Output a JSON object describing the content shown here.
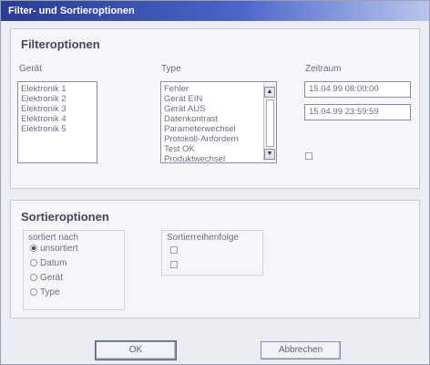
{
  "window": {
    "title": "Filter- und Sortieroptionen"
  },
  "filter": {
    "title": "Filteroptionen",
    "geraet": {
      "label": "Gerät",
      "items": [
        "Elektronik 1",
        "Elektronik 2",
        "Elektronik 3",
        "Elektronik 4",
        "Elektronik 5"
      ]
    },
    "type": {
      "label": "Type",
      "items": [
        "Fehler",
        "Gerät EIN",
        "Gerät AUS",
        "Datenkontrast",
        "Parameterwechsel",
        "Protokoll-Anfordern",
        "Test OK",
        "Produktwechsel"
      ]
    },
    "zeitraum": {
      "label": "Zeitraum",
      "from": "15.04.99 08:00:00",
      "to": "15.04.99 23:59:59"
    }
  },
  "sort": {
    "title": "Sortieroptionen",
    "sortiert_nach": {
      "label": "sortiert nach",
      "options": [
        "unsortiert",
        "Datum",
        "Gerät",
        "Type"
      ],
      "selected": "unsortiert"
    },
    "reihenfolge": {
      "label": "Sortierreihenfolge"
    }
  },
  "buttons": {
    "ok": "OK",
    "cancel": "Abbrechen"
  },
  "colors": {
    "title_start": "#2a3c8e",
    "title_end": "#b9c5ee"
  }
}
